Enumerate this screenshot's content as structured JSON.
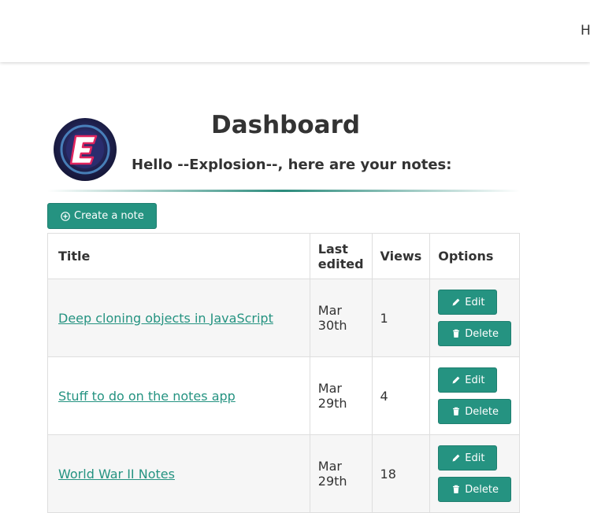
{
  "nav": {
    "item": "H"
  },
  "header": {
    "title": "Dashboard",
    "greeting": "Hello --Explosion--, here are your notes:"
  },
  "actions": {
    "create_label": "Create a note"
  },
  "table": {
    "headers": {
      "title": "Title",
      "last_edited": "Last edited",
      "views": "Views",
      "options": "Options"
    },
    "rows": [
      {
        "title": "Deep cloning objects in JavaScript",
        "date": "Mar 30th",
        "views": "1",
        "edit": "Edit",
        "delete": "Delete"
      },
      {
        "title": "Stuff to do on the notes app",
        "date": "Mar 29th",
        "views": "4",
        "edit": "Edit",
        "delete": "Delete"
      },
      {
        "title": "World War II Notes",
        "date": "Mar 29th",
        "views": "18",
        "edit": "Edit",
        "delete": "Delete"
      }
    ]
  },
  "colors": {
    "accent": "#259381",
    "text": "#333333"
  }
}
